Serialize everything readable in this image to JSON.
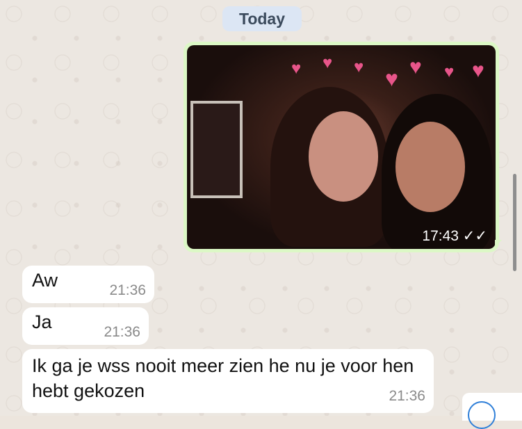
{
  "date_separator": "Today",
  "image_message": {
    "time": "17:43",
    "status": "read-double-check"
  },
  "messages": [
    {
      "text": "Aw",
      "time": "21:36"
    },
    {
      "text": "Ja",
      "time": "21:36"
    },
    {
      "text": "Ik ga je wss nooit meer zien he nu je voor hen hebt gekozen",
      "time": "21:36"
    }
  ],
  "colors": {
    "outgoing": "#dcf8c6",
    "incoming": "#ffffff",
    "date_bg": "#dce6f4"
  }
}
